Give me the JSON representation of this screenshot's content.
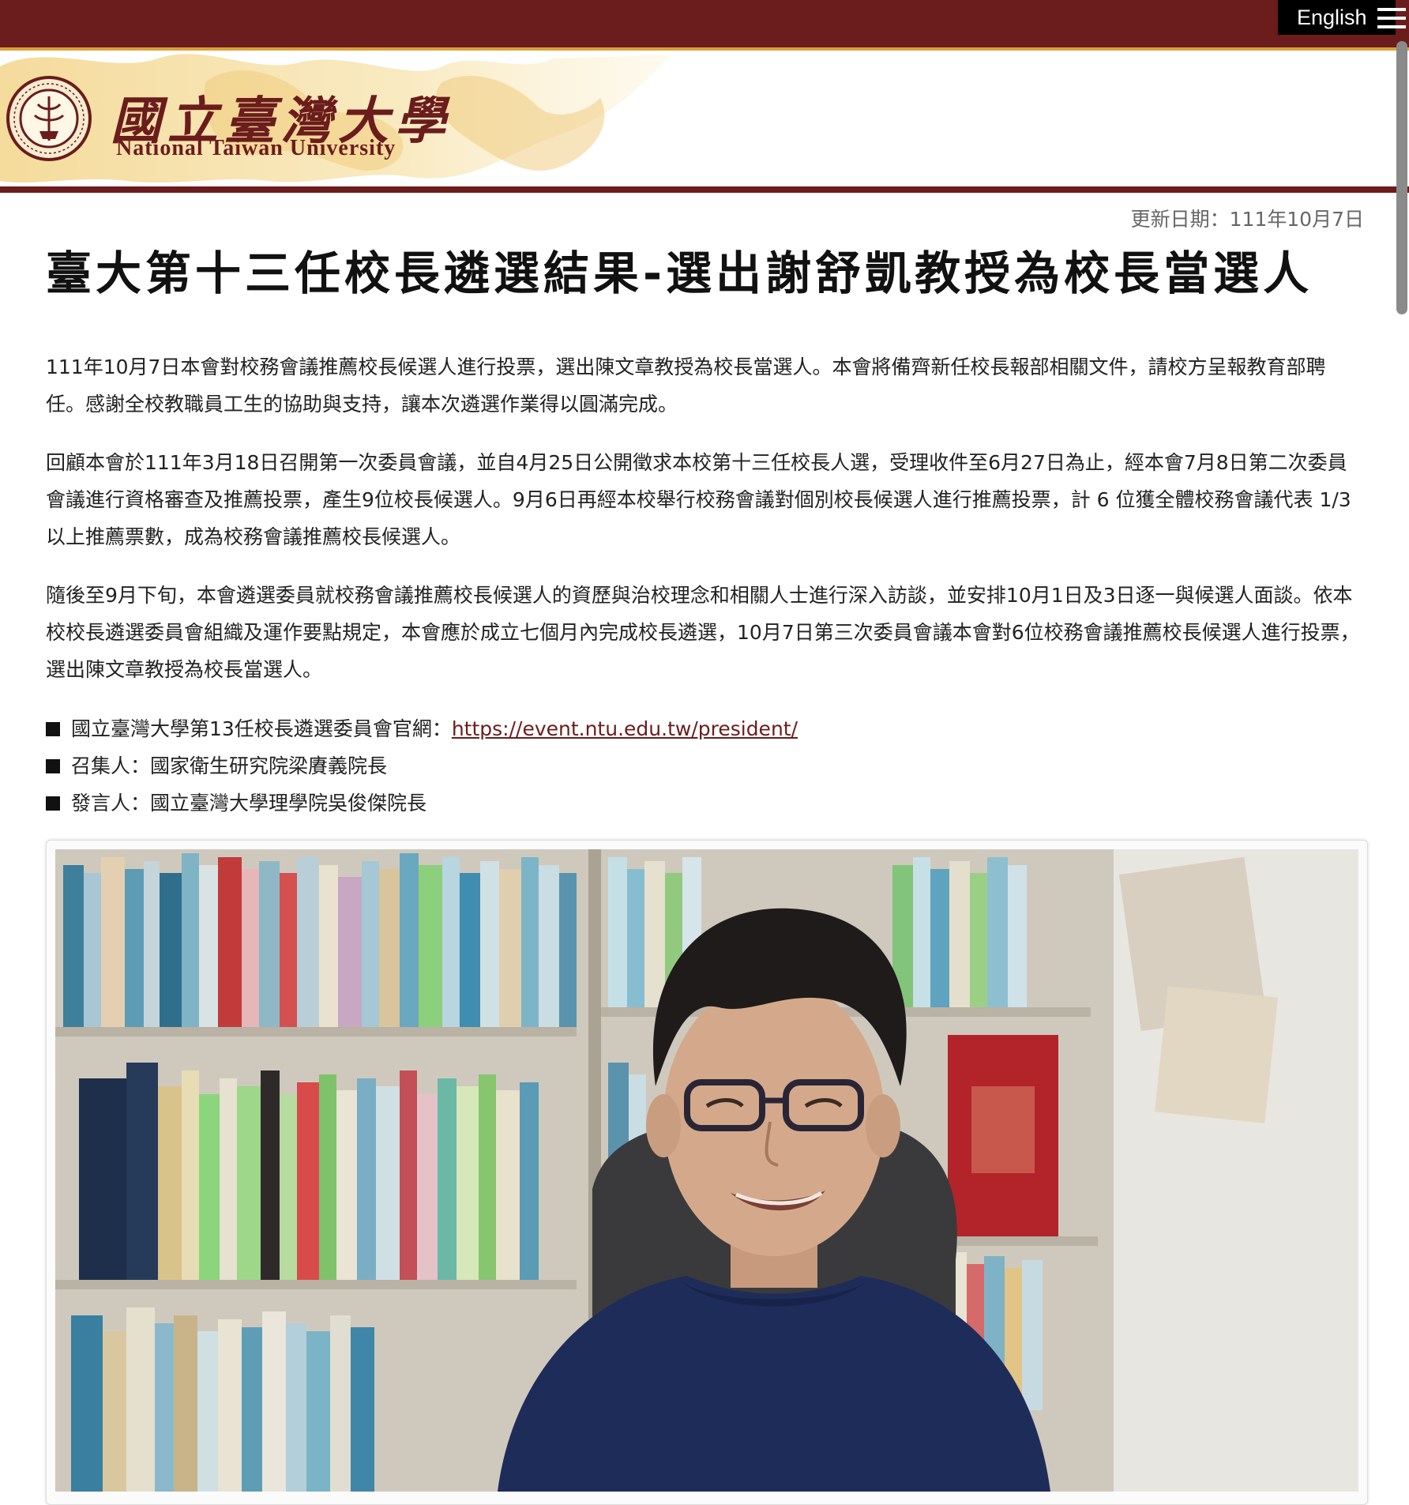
{
  "header": {
    "language_button": "English",
    "menu_icon": "hamburger-menu-icon",
    "logo_icon": "ntu-seal-icon",
    "logo_chinese": "國立臺灣大學",
    "logo_english": "National Taiwan University",
    "colors": {
      "maroon": "#6b1c1c",
      "gold": "#d9a13b"
    }
  },
  "article": {
    "update_date": "更新日期：111年10月7日",
    "title": "臺大第十三任校長遴選結果-選出謝舒凱教授為校長當選人",
    "paragraphs": [
      "111年10月7日本會對校務會議推薦校長候選人進行投票，選出陳文章教授為校長當選人。本會將備齊新任校長報部相關文件，請校方呈報教育部聘任。感謝全校教職員工生的協助與支持，讓本次遴選作業得以圓滿完成。",
      "回顧本會於111年3月18日召開第一次委員會議，並自4月25日公開徵求本校第十三任校長人選，受理收件至6月27日為止，經本會7月8日第二次委員會議進行資格審查及推薦投票，產生9位校長候選人。9月6日再經本校舉行校務會議對個別校長候選人進行推薦投票，計 6 位獲全體校務會議代表 1/3 以上推薦票數，成為校務會議推薦校長候選人。",
      "隨後至9月下旬，本會遴選委員就校務會議推薦校長候選人的資歷與治校理念和相關人士進行深入訪談，並安排10月1日及3日逐一與候選人面談。依本校校長遴選委員會組織及運作要點規定，本會應於成立七個月內完成校長遴選，10月7日第三次委員會議本會對6位校務會議推薦校長候選人進行投票，選出陳文章教授為校長當選人。"
    ],
    "bullets": [
      {
        "label": "國立臺灣大學第13任校長遴選委員會官網：",
        "link": "https://event.ntu.edu.tw/president/"
      },
      {
        "label": "召集人：國家衛生研究院梁賡義院長",
        "link": ""
      },
      {
        "label": "發言人：國立臺灣大學理學院吳俊傑院長",
        "link": ""
      }
    ],
    "photo_description_icon": "president-portrait-photo"
  }
}
